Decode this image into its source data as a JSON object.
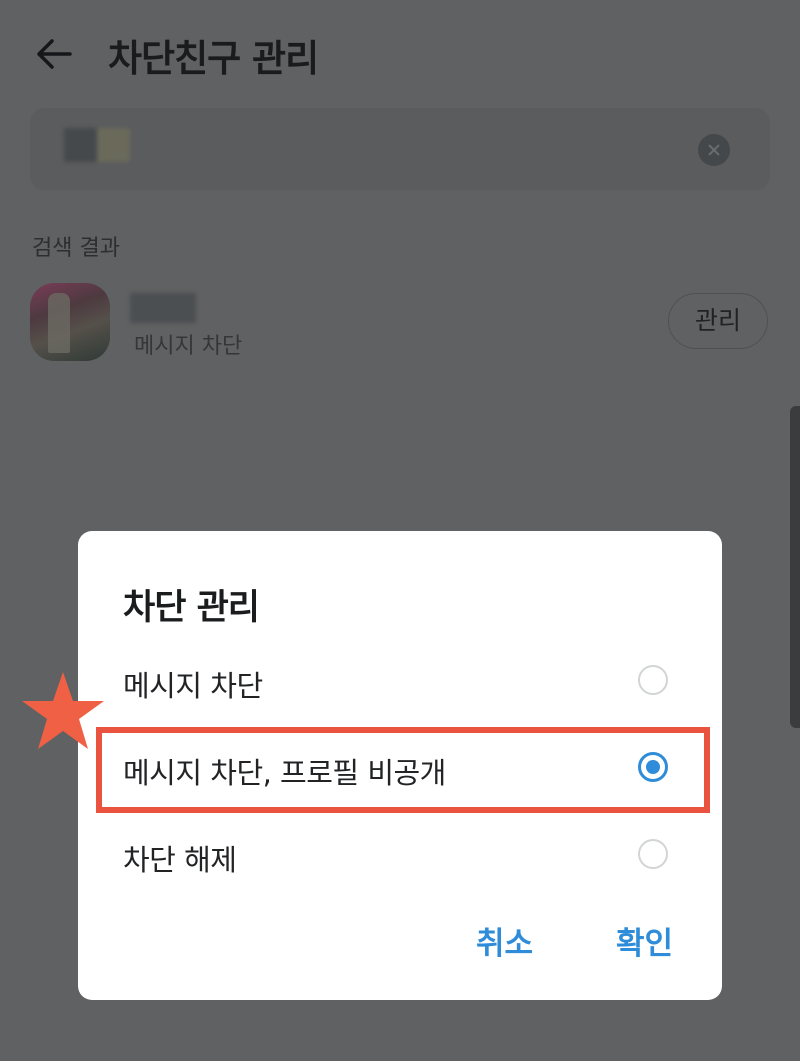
{
  "header": {
    "title": "차단친구 관리",
    "back_icon": "arrow-left-icon"
  },
  "search": {
    "query": "",
    "clear_icon": "clear-icon"
  },
  "results": {
    "section_label": "검색 결과",
    "items": [
      {
        "name": "",
        "status": "메시지 차단",
        "manage_label": "관리"
      }
    ]
  },
  "dialog": {
    "title": "차단 관리",
    "options": [
      {
        "label": "메시지 차단",
        "selected": false
      },
      {
        "label": "메시지 차단, 프로필 비공개",
        "selected": true
      },
      {
        "label": "차단 해제",
        "selected": false
      }
    ],
    "cancel_label": "취소",
    "confirm_label": "확인"
  },
  "annotation": {
    "highlight_color": "#e9533f",
    "star_color": "#f06045",
    "star_icon": "star-icon"
  },
  "colors": {
    "accent": "#2f8cd9",
    "overlay": "#5f6163",
    "dialog_bg": "#ffffff"
  }
}
